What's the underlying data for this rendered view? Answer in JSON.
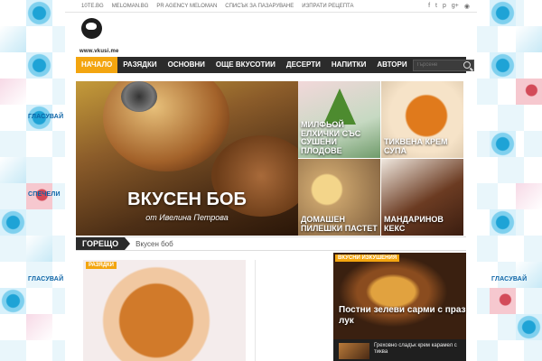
{
  "topbar": {
    "links": [
      "10TE.BG",
      "MELOMAN.BG",
      "PR AGENCY MELOMAN",
      "СПИСЪК ЗА ПАЗАРУВАНЕ",
      "ИЗПРАТИ РЕЦЕПТА"
    ],
    "social_icons": [
      "facebook-icon",
      "twitter-icon",
      "pinterest-icon",
      "google-plus-icon",
      "rss-icon"
    ]
  },
  "logo": {
    "text": "www.vkusi.me"
  },
  "nav": {
    "items": [
      "НАЧАЛО",
      "РАЗЯДКИ",
      "ОСНОВНИ",
      "ОЩЕ ВКУСОТИИ",
      "ДЕСЕРТИ",
      "НАПИТКИ",
      "АВТОРИ"
    ],
    "active_index": 0,
    "search_placeholder": "Търсене"
  },
  "hero": {
    "title": "ВКУСЕН БОБ",
    "author": "от Ивелина Петрова"
  },
  "featured": [
    {
      "caption": "Милфьой елхички със сушени плодове"
    },
    {
      "caption": "Тиквена крем супа"
    },
    {
      "caption": "Домашен пилешки пастет"
    },
    {
      "caption": "Мандаринов кекс"
    }
  ],
  "trending": {
    "label": "ГОРЕЩО",
    "text": "Вкусен боб"
  },
  "post": {
    "category": "РАЗЯДКИ"
  },
  "widget": {
    "category": "ВКУСНИ ИЗКУШЕНИЯ",
    "title": "Постни зелеви сарми с праз лук",
    "item_title": "Греховно сладък крем карамел с тиква"
  },
  "ads": {
    "left": [
      "ГЛАСУВАЙ",
      "СПЕЧЕЛИ",
      "ГЛАСУВАЙ"
    ],
    "right": [
      "ГЛАСУВАЙ"
    ]
  },
  "colors": {
    "accent": "#f3a50f",
    "nav_bg": "#2b2b2b"
  }
}
